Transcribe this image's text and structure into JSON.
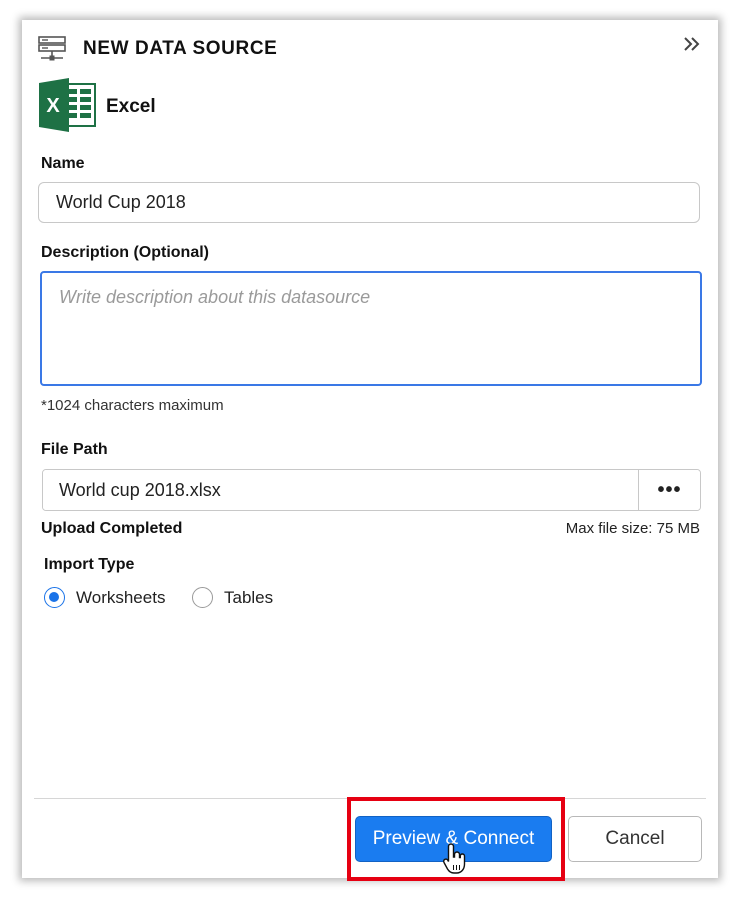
{
  "header": {
    "title": "NEW DATA SOURCE",
    "left_icon": "data-source-server-icon",
    "right_icon": "double-chevron-right-icon"
  },
  "source": {
    "label": "Excel",
    "icon": "excel-icon"
  },
  "form": {
    "name_label": "Name",
    "name_value": "World Cup 2018",
    "description_label": "Description (Optional)",
    "description_value": "",
    "description_placeholder": "Write description about this datasource",
    "char_limit_hint": "*1024 characters maximum",
    "file_path_label": "File Path",
    "file_path_value": "World cup 2018.xlsx",
    "browse_label": "•••",
    "upload_status": "Upload Completed",
    "max_file_size": "Max file size: 75 MB",
    "import_type_label": "Import Type",
    "import_options": [
      {
        "label": "Worksheets",
        "selected": true
      },
      {
        "label": "Tables",
        "selected": false
      }
    ]
  },
  "footer": {
    "primary_label": "Preview & Connect",
    "cancel_label": "Cancel"
  },
  "colors": {
    "accent": "#1a7cf0",
    "highlight": "#e60012",
    "excel_green": "#1e7145"
  },
  "cursor_icon": "hand-pointer-icon"
}
